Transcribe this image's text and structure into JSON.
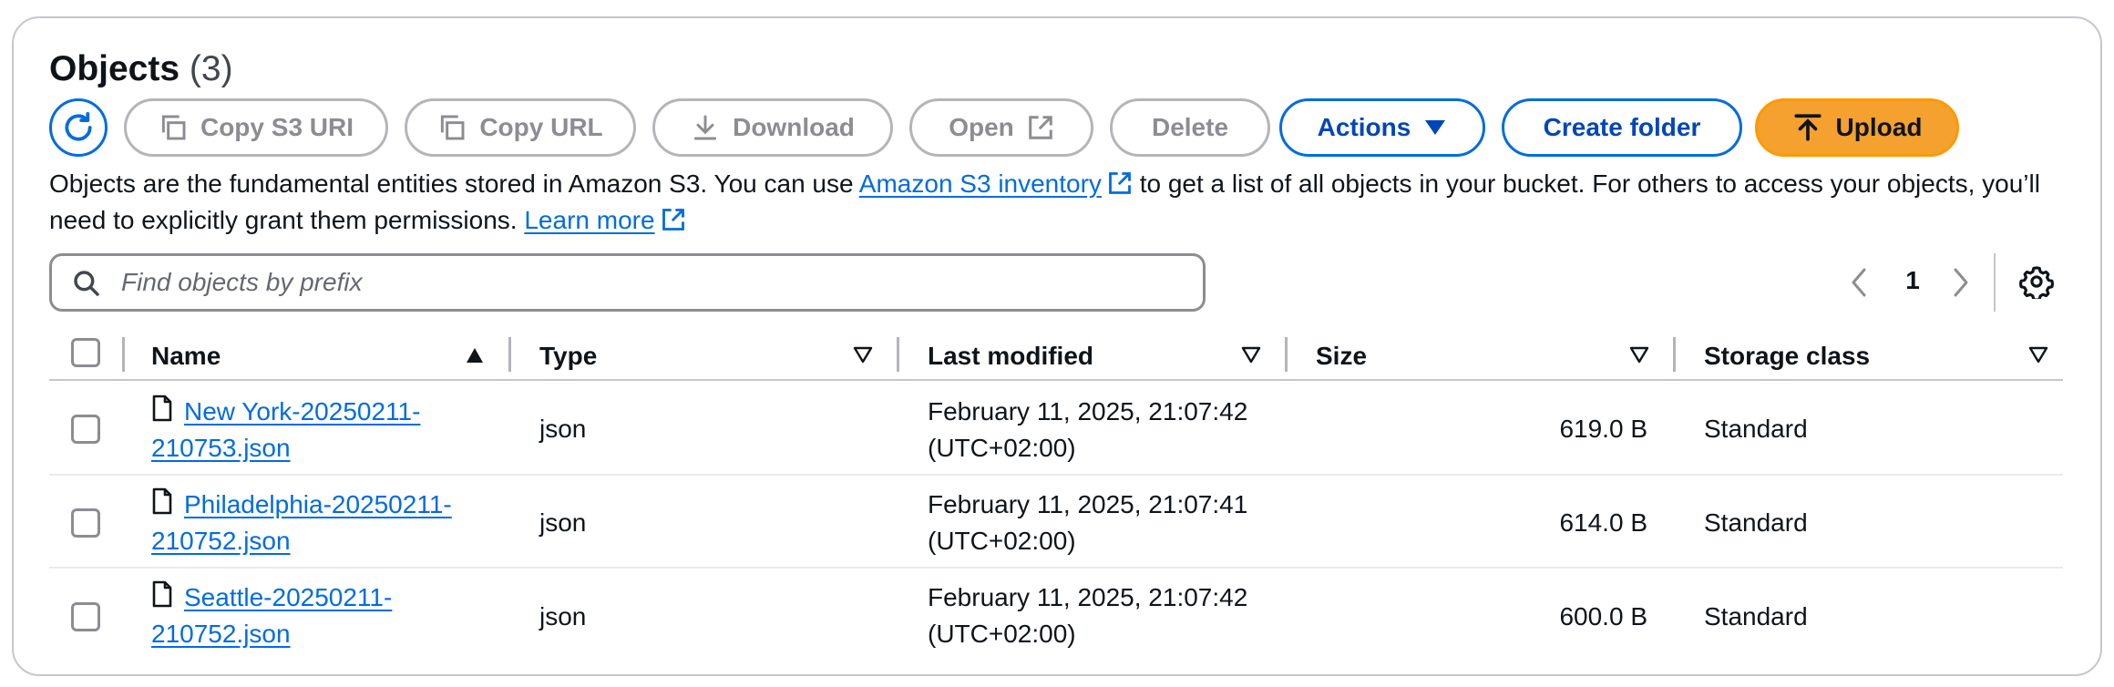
{
  "header": {
    "title": "Objects",
    "count": "(3)"
  },
  "toolbar": {
    "copy_s3_uri": "Copy S3 URI",
    "copy_url": "Copy URL",
    "download": "Download",
    "open": "Open",
    "delete": "Delete",
    "actions": "Actions",
    "create_folder": "Create folder",
    "upload": "Upload"
  },
  "description": {
    "text1": "Objects are the fundamental entities stored in Amazon S3. You can use ",
    "inventory_link": "Amazon S3 inventory",
    "text2": " to get a list of all objects in your bucket. For others to access your objects, you’ll need to explicitly grant them permissions. ",
    "learn_more": "Learn more"
  },
  "search": {
    "placeholder": "Find objects by prefix",
    "value": ""
  },
  "pagination": {
    "current_page": "1"
  },
  "table": {
    "columns": {
      "name": "Name",
      "type": "Type",
      "last_modified": "Last modified",
      "size": "Size",
      "storage_class": "Storage class"
    },
    "rows": [
      {
        "name_line1": "New York-20250211-",
        "name_line2": "210753.json",
        "type": "json",
        "modified_line1": "February 11, 2025, 21:07:42",
        "modified_line2": "(UTC+02:00)",
        "size": "619.0 B",
        "storage_class": "Standard"
      },
      {
        "name_line1": "Philadelphia-20250211-",
        "name_line2": "210752.json",
        "type": "json",
        "modified_line1": "February 11, 2025, 21:07:41",
        "modified_line2": "(UTC+02:00)",
        "size": "614.0 B",
        "storage_class": "Standard"
      },
      {
        "name_line1": "Seattle-20250211-",
        "name_line2": "210752.json",
        "type": "json",
        "modified_line1": "February 11, 2025, 21:07:42",
        "modified_line2": "(UTC+02:00)",
        "size": "600.0 B",
        "storage_class": "Standard"
      }
    ]
  },
  "colors": {
    "link": "#006ce0",
    "primary_button": "#f4a12f",
    "border": "#c6c6cd",
    "disabled_text": "#8c8c94"
  },
  "icons": [
    "refresh-icon",
    "copy-icon",
    "download-icon",
    "external-link-icon",
    "caret-down-icon",
    "upload-icon",
    "search-icon",
    "chevron-left-icon",
    "chevron-right-icon",
    "gear-icon",
    "file-icon",
    "sort-ascending-icon",
    "sort-icon"
  ]
}
